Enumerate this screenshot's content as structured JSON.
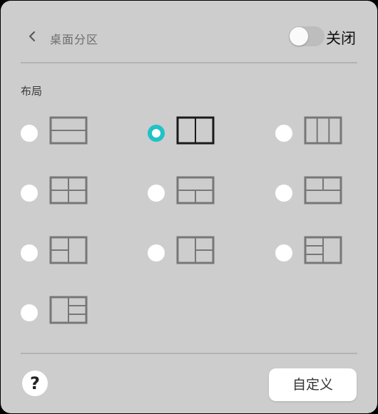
{
  "header": {
    "back_icon": "chevron-left-icon",
    "title": "桌面分区",
    "toggle_state": "off",
    "toggle_label": "关闭"
  },
  "layout_section": {
    "label": "布局",
    "selected_index": 1,
    "options": [
      {
        "name": "two-rows"
      },
      {
        "name": "two-columns"
      },
      {
        "name": "three-columns"
      },
      {
        "name": "four-grid"
      },
      {
        "name": "top-one-bottom-two"
      },
      {
        "name": "top-two-bottom-one"
      },
      {
        "name": "left-two-right-one"
      },
      {
        "name": "left-one-right-two"
      },
      {
        "name": "left-three-right-one"
      },
      {
        "name": "left-one-right-three"
      }
    ]
  },
  "footer": {
    "help_label": "?",
    "custom_button": "自定义"
  },
  "colors": {
    "panel_bg": "#cdcdcd",
    "accent": "#1fc2c7",
    "icon_stroke": "#777777",
    "icon_stroke_selected": "#1a1a1a"
  }
}
